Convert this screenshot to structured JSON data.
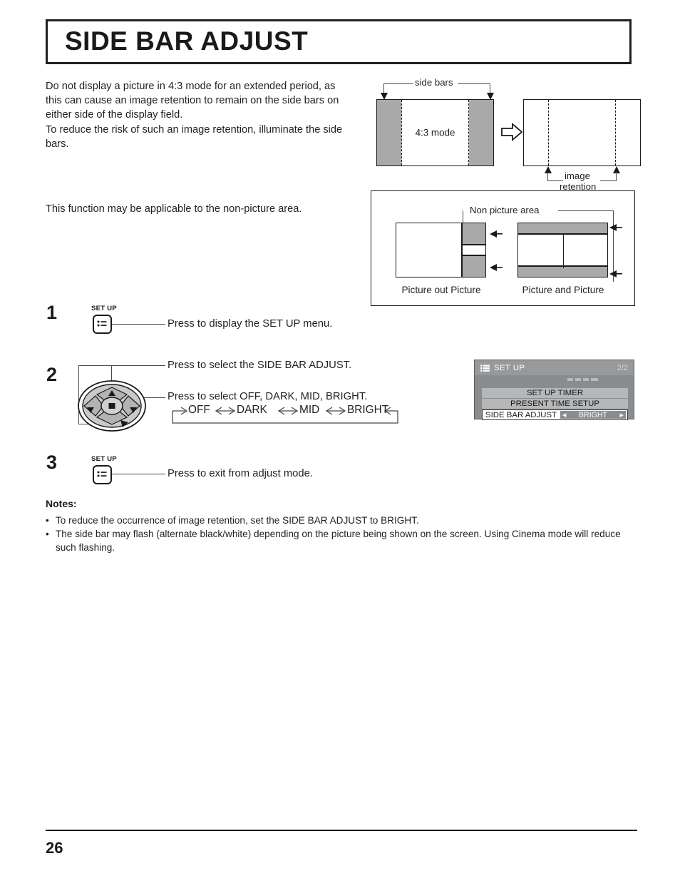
{
  "document": {
    "title": "SIDE BAR ADJUST",
    "page_number": "26"
  },
  "intro": {
    "paragraph1": "Do not display a picture in 4:3 mode for an extended period, as this can cause an image retention to remain on the side bars on either side of the display field.\nTo reduce the risk of such an image retention, illuminate the side bars.",
    "paragraph2": "This function may be applicable to the non-picture area."
  },
  "diagram_top": {
    "side_bars_label": "side bars",
    "mode_label": "4:3 mode",
    "image_retention_line1": "image",
    "image_retention_line2": "retention",
    "arrow_icon": "block-arrow-right-icon"
  },
  "diagram_non_picture": {
    "heading": "Non picture area",
    "caption_left": "Picture out Picture",
    "caption_right": "Picture and Picture"
  },
  "steps": [
    {
      "number": "1",
      "button_caption": "SET UP",
      "button_icon": "setup-menu-icon",
      "instruction": "Press to display the SET UP menu."
    },
    {
      "number": "2",
      "instruction_top": "Press to select the SIDE BAR ADJUST.",
      "instruction_bottom": "Press to select OFF, DARK, MID, BRIGHT.",
      "control_icon": "dpad-navigation-icon",
      "cycle": [
        "OFF",
        "DARK",
        "MID",
        "BRIGHT"
      ]
    },
    {
      "number": "3",
      "button_caption": "SET UP",
      "button_icon": "setup-menu-icon",
      "instruction": "Press to exit from adjust mode."
    }
  ],
  "osd": {
    "icon": "list-icon",
    "title": "SET UP",
    "page_indicator": "2/2",
    "rows": [
      {
        "label": "SET UP TIMER",
        "selected": false
      },
      {
        "label": "PRESENT TIME SETUP",
        "selected": false
      }
    ],
    "selected_row": {
      "label": "SIDE BAR ADJUST",
      "value": "BRIGHT",
      "left_arrow": "◀",
      "right_arrow": "▶"
    }
  },
  "notes": {
    "heading": "Notes:",
    "items": [
      "To reduce the occurrence of image retention, set the SIDE BAR ADJUST to BRIGHT.",
      "The side bar may flash (alternate black/white) depending on the picture being shown on the screen. Using Cinema mode will reduce such flashing."
    ],
    "bullet": "•"
  },
  "colors": {
    "gray_fill": "#a9a9a9",
    "osd_bg": "#8a8d8f",
    "osd_row": "#b5b7b9",
    "ink": "#1a1a1a"
  }
}
